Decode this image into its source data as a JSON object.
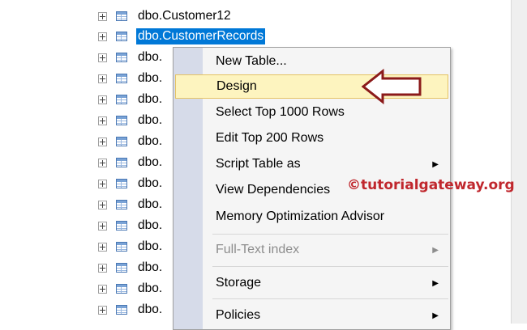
{
  "tree": {
    "items": [
      {
        "label": "dbo.Customer12",
        "selected": false
      },
      {
        "label": "dbo.CustomerRecords",
        "selected": true
      },
      {
        "label": "dbo."
      },
      {
        "label": "dbo."
      },
      {
        "label": "dbo."
      },
      {
        "label": "dbo."
      },
      {
        "label": "dbo."
      },
      {
        "label": "dbo."
      },
      {
        "label": "dbo."
      },
      {
        "label": "dbo."
      },
      {
        "label": "dbo."
      },
      {
        "label": "dbo."
      },
      {
        "label": "dbo."
      },
      {
        "label": "dbo."
      },
      {
        "label": "dbo."
      }
    ]
  },
  "context_menu": {
    "items": [
      {
        "label": "New Table..."
      },
      {
        "label": "Design",
        "highlighted": true
      },
      {
        "label": "Select Top 1000 Rows"
      },
      {
        "label": "Edit Top 200 Rows"
      },
      {
        "label": "Script Table as",
        "submenu": true
      },
      {
        "label": "View Dependencies"
      },
      {
        "label": "Memory Optimization Advisor"
      },
      {
        "label": "Full-Text index",
        "submenu": true,
        "disabled": true
      },
      {
        "label": "Storage",
        "submenu": true
      },
      {
        "label": "Policies",
        "submenu": true
      }
    ]
  },
  "watermark": "©tutorialgateway.org",
  "colors": {
    "selection": "#0078d7",
    "menu_highlight": "#fdf4bf",
    "arrow": "#8b1a1a",
    "watermark": "#c0272d"
  }
}
